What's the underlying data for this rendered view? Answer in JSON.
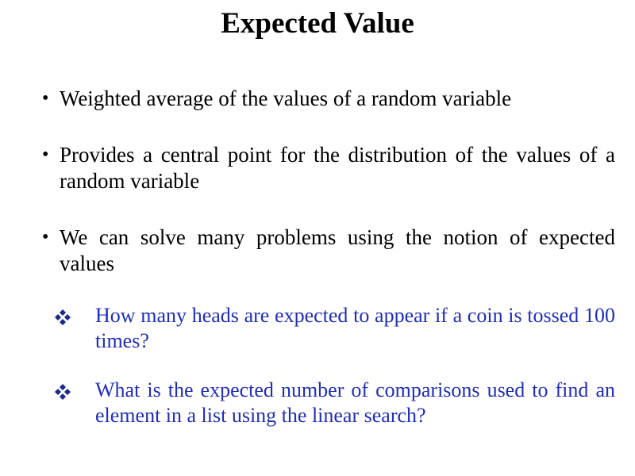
{
  "slide": {
    "title": "Expected Value",
    "bullets": [
      "Weighted average of the values of a random variable",
      "Provides a central point for the distribution of the values of a random variable",
      "We can solve many problems using the notion of expected values"
    ],
    "sub_items": [
      "How many heads are expected to appear if a coin is tossed 100 times?",
      "What is the expected number of comparisons used to find an element in a list using the linear search?"
    ],
    "bullet_glyph": "•",
    "sub_icon": "four-diamond-icon",
    "colors": {
      "text": "#000000",
      "sub_text": "#1f2eb8",
      "sub_icon": "#1a2a8c",
      "background": "#ffffff"
    }
  }
}
